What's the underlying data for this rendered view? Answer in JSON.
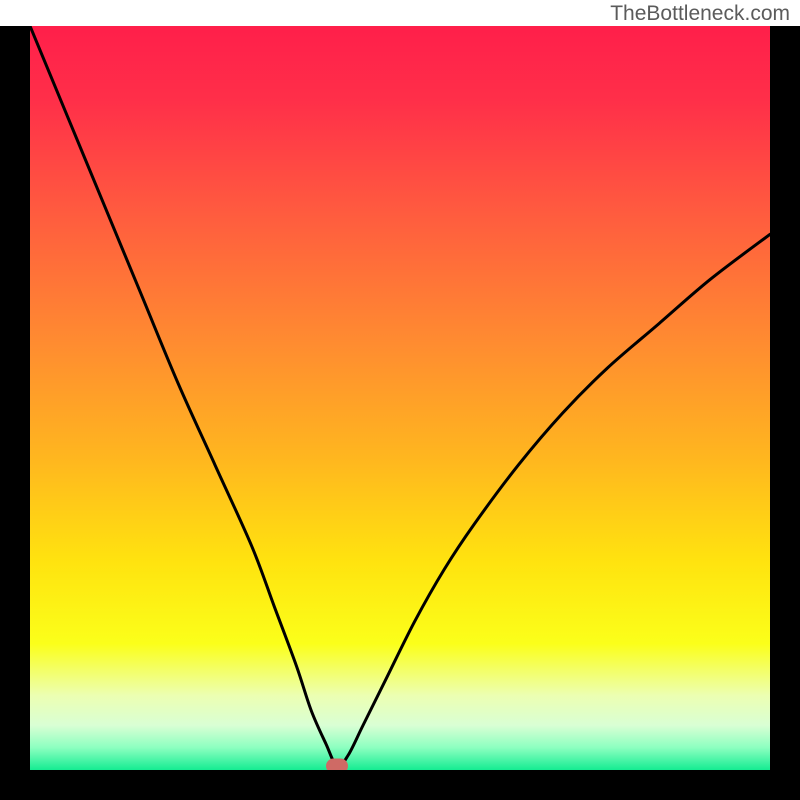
{
  "watermark": "TheBottleneck.com",
  "chart_data": {
    "type": "line",
    "title": "",
    "xlabel": "",
    "ylabel": "",
    "xlim": [
      0,
      100
    ],
    "ylim": [
      0,
      100
    ],
    "x": [
      0,
      5,
      10,
      15,
      20,
      25,
      30,
      33,
      36,
      38,
      40,
      41.5,
      43,
      45,
      48,
      52,
      56,
      60,
      66,
      72,
      78,
      85,
      92,
      100
    ],
    "y": [
      100,
      88,
      76,
      64,
      52,
      41,
      30,
      22,
      14,
      8,
      3.5,
      0.5,
      2,
      6,
      12,
      20,
      27,
      33,
      41,
      48,
      54,
      60,
      66,
      72
    ],
    "minimum_marker": {
      "x": 41.5,
      "y": 0.5
    },
    "gradient_stops": [
      {
        "pos": 0.0,
        "color": "#ff1f4a"
      },
      {
        "pos": 0.1,
        "color": "#ff2f49"
      },
      {
        "pos": 0.25,
        "color": "#ff5b3f"
      },
      {
        "pos": 0.42,
        "color": "#ff8a31"
      },
      {
        "pos": 0.58,
        "color": "#ffb61f"
      },
      {
        "pos": 0.72,
        "color": "#ffe30f"
      },
      {
        "pos": 0.83,
        "color": "#fbff1a"
      },
      {
        "pos": 0.9,
        "color": "#ecffb2"
      },
      {
        "pos": 0.94,
        "color": "#d9ffd4"
      },
      {
        "pos": 0.97,
        "color": "#8cffc0"
      },
      {
        "pos": 1.0,
        "color": "#15ec92"
      }
    ]
  }
}
